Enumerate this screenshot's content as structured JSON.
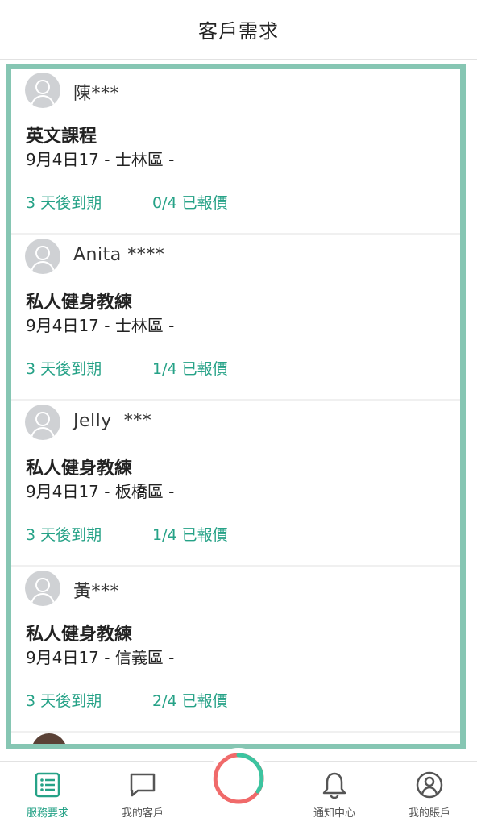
{
  "header": {
    "title": "客戶需求"
  },
  "requests": [
    {
      "name": "陳***",
      "service": "英文課程",
      "detail": "9月4日17 - 士林區 -",
      "expire": "3 天後到期",
      "quoted": "0/4 已報價"
    },
    {
      "name": "Anita ****",
      "service": "私人健身教練",
      "detail": "9月4日17 - 士林區 -",
      "expire": "3 天後到期",
      "quoted": "1/4 已報價"
    },
    {
      "name": "Jelly  ***",
      "service": "私人健身教練",
      "detail": "9月4日17 - 板橋區 -",
      "expire": "3 天後到期",
      "quoted": "1/4 已報價"
    },
    {
      "name": "黃***",
      "service": "私人健身教練",
      "detail": "9月4日17 - 信義區 -",
      "expire": "3 天後到期",
      "quoted": "2/4 已報價"
    }
  ],
  "tabs": [
    {
      "label": "服務要求",
      "icon": "list-icon",
      "active": true
    },
    {
      "label": "我的客戶",
      "icon": "chat-icon",
      "active": false
    },
    {
      "label": "通知中心",
      "icon": "bell-icon",
      "active": false
    },
    {
      "label": "我的賬戶",
      "icon": "user-icon",
      "active": false
    }
  ],
  "colors": {
    "accent": "#26a287",
    "frame": "#86c6b3",
    "ring_red": "#f06a6a",
    "ring_green": "#3cc4a0"
  }
}
